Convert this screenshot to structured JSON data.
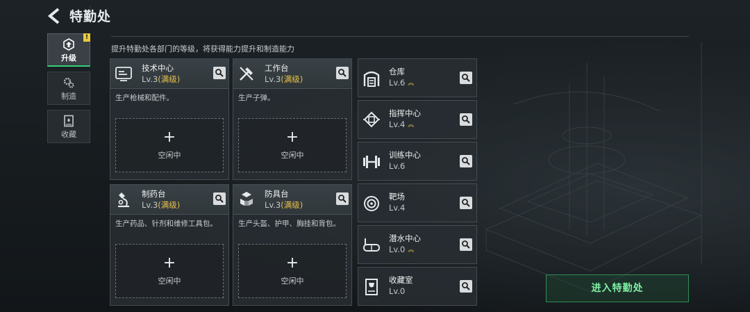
{
  "header": {
    "title": "特勤处",
    "subtitle": "提升特勤处各部门的等级，将获得能力提升和制造能力"
  },
  "side_tabs": [
    {
      "label": "升级",
      "icon": "upgrade-icon",
      "active": true,
      "badge": "!"
    },
    {
      "label": "制造",
      "icon": "gears-icon",
      "active": false
    },
    {
      "label": "收藏",
      "icon": "collection-icon",
      "active": false
    }
  ],
  "departments": [
    {
      "name": "技术中心",
      "level": "Lv.3",
      "max": "(满级)",
      "desc": "生产枪械和配件。",
      "slot_label": "空闲中",
      "icon": "tech-center-icon"
    },
    {
      "name": "工作台",
      "level": "Lv.3",
      "max": "(满级)",
      "desc": "生产子弹。",
      "slot_label": "空闲中",
      "icon": "workbench-icon"
    },
    {
      "name": "制药台",
      "level": "Lv.3",
      "max": "(满级)",
      "desc": "生产药品、针剂和维修工具包。",
      "slot_label": "空闲中",
      "icon": "microscope-icon"
    },
    {
      "name": "防具台",
      "level": "Lv.3",
      "max": "(满级)",
      "desc": "生产头盔、护甲、胸挂和背包。",
      "slot_label": "空闲中",
      "icon": "armor-icon"
    }
  ],
  "facilities": [
    {
      "name": "仓库",
      "level": "Lv.6",
      "upgradable": true,
      "icon": "warehouse-icon"
    },
    {
      "name": "指挥中心",
      "level": "Lv.4",
      "upgradable": true,
      "icon": "chip-icon"
    },
    {
      "name": "训练中心",
      "level": "Lv.6",
      "upgradable": false,
      "icon": "dumbbell-icon"
    },
    {
      "name": "靶场",
      "level": "Lv.4",
      "upgradable": false,
      "icon": "target-icon"
    },
    {
      "name": "潜水中心",
      "level": "Lv.0",
      "upgradable": true,
      "icon": "diving-mask-icon"
    },
    {
      "name": "收藏室",
      "level": "Lv.0",
      "upgradable": false,
      "icon": "trophy-case-icon"
    }
  ],
  "enter_button": "进入特勤处",
  "colors": {
    "accent_green": "#36d17a",
    "max_gold": "#e8c24a"
  }
}
